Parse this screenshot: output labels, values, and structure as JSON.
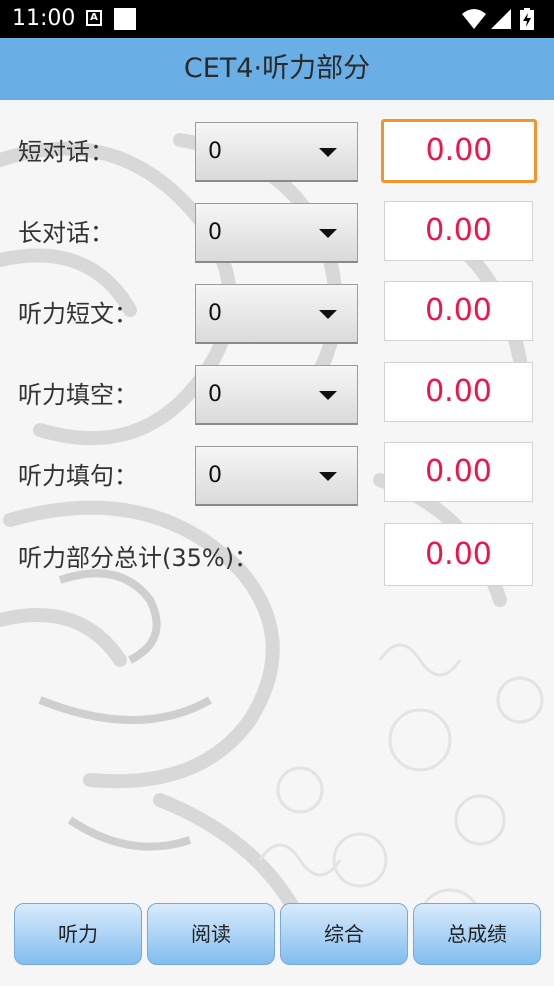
{
  "status_bar": {
    "time": "11:00",
    "icons": [
      "a-icon",
      "notification-square-icon",
      "wifi-icon",
      "signal-icon",
      "battery-charging-icon"
    ]
  },
  "app_bar": {
    "title": "CET4·听力部分"
  },
  "rows": [
    {
      "label": "短对话：",
      "select_value": "0",
      "score": "0.00",
      "focused": true
    },
    {
      "label": "长对话：",
      "select_value": "0",
      "score": "0.00"
    },
    {
      "label": "听力短文：",
      "select_value": "0",
      "score": "0.00"
    },
    {
      "label": "听力填空：",
      "select_value": "0",
      "score": "0.00"
    },
    {
      "label": "听力填句：",
      "select_value": "0",
      "score": "0.00"
    }
  ],
  "total": {
    "label": "听力部分总计(35%)：",
    "score": "0.00"
  },
  "bottom_nav": [
    "听力",
    "阅读",
    "综合",
    "总成绩"
  ],
  "colors": {
    "app_bar": "#6aaee6",
    "score_text": "#f0134a",
    "focus_border": "#f0962e",
    "nav_button": "#82bdf0"
  }
}
